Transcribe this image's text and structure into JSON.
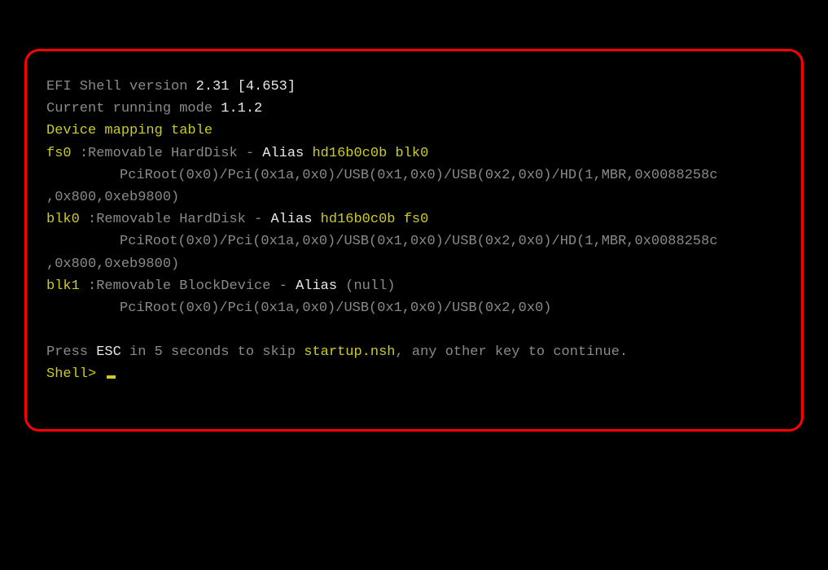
{
  "header": {
    "title_prefix": "EFI Shell version ",
    "version": "2.31 [4.653]",
    "mode_prefix": "Current running mode ",
    "mode_version": "1.1.2",
    "table_label": "Device mapping table"
  },
  "devices": [
    {
      "name": "fs0",
      "name_pad": "  fs0 ",
      "type": " :Removable HardDisk - ",
      "alias_label": "Alias ",
      "alias_value": "hd16b0c0b blk0",
      "path_line": "PciRoot(0x0)/Pci(0x1a,0x0)/USB(0x1,0x0)/USB(0x2,0x0)/HD(1,MBR,0x0088258c",
      "path_cont": ",0x800,0xeb9800)"
    },
    {
      "name": "blk0",
      "name_pad": "  blk0",
      "type": " :Removable HardDisk - ",
      "alias_label": "Alias ",
      "alias_value": "hd16b0c0b fs0",
      "path_line": "PciRoot(0x0)/Pci(0x1a,0x0)/USB(0x1,0x0)/USB(0x2,0x0)/HD(1,MBR,0x0088258c",
      "path_cont": ",0x800,0xeb9800)"
    },
    {
      "name": "blk1",
      "name_pad": "  blk1",
      "type": " :Removable BlockDevice - ",
      "alias_label": "Alias ",
      "alias_value": "(null)",
      "path_line": "PciRoot(0x0)/Pci(0x1a,0x0)/USB(0x1,0x0)/USB(0x2,0x0)",
      "path_cont": ""
    }
  ],
  "footer": {
    "press": "Press ",
    "esc": "ESC",
    "mid1": " in 5 seconds to skip ",
    "startup": "startup.nsh",
    "mid2": ", any other key to continue.",
    "prompt": "Shell> "
  }
}
